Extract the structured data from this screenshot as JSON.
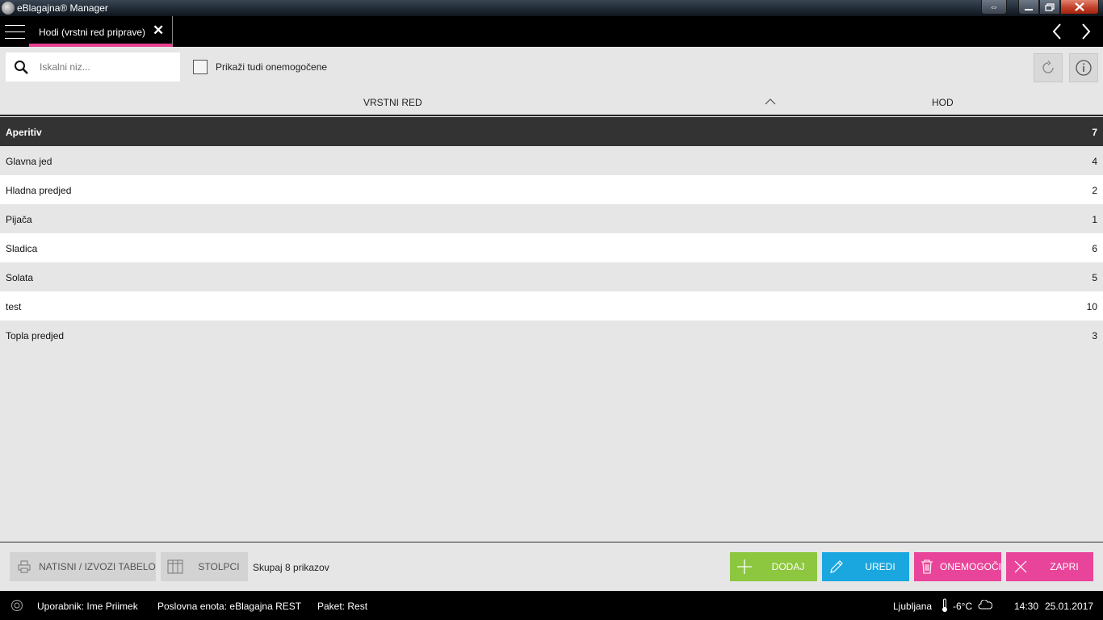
{
  "window": {
    "title": "eBlagajna® Manager"
  },
  "tab": {
    "label": "Hodi (vrstni red priprave)"
  },
  "toolbar": {
    "search_placeholder": "Iskalni niz...",
    "search_value": "",
    "show_disabled_label": "Prikaži tudi onemogočene",
    "show_disabled_checked": false
  },
  "table": {
    "columns": [
      "VRSTNI RED",
      "HOD"
    ],
    "sort_column": "VRSTNI RED",
    "sort_direction": "ascending",
    "rows": [
      {
        "name": "Aperitiv",
        "value": "7"
      },
      {
        "name": "Glavna jed",
        "value": "4"
      },
      {
        "name": "Hladna predjed",
        "value": "2"
      },
      {
        "name": "Pijača",
        "value": "1"
      },
      {
        "name": "Sladica",
        "value": "6"
      },
      {
        "name": "Solata",
        "value": "5"
      },
      {
        "name": "test",
        "value": "10"
      },
      {
        "name": "Topla predjed",
        "value": "3"
      }
    ],
    "selected_row": 0
  },
  "footer": {
    "print_label": "NATISNI / IZVOZI TABELO",
    "columns_label": "STOLPCI",
    "total_label": "Skupaj 8 prikazov",
    "add_label": "DODAJ",
    "edit_label": "UREDI",
    "disable_label": "ONEMOGOČI",
    "close_label": "ZAPRI"
  },
  "status": {
    "user": "Uporabnik: Ime Priimek",
    "business_unit": "Poslovna enota: eBlagajna REST",
    "package": "Paket: Rest",
    "city": "Ljubljana",
    "temperature": "-6°C",
    "time": "14:30",
    "date": "25.01.2017"
  },
  "colors": {
    "accent_pink": "#e8459a",
    "add_green": "#8dc63f",
    "edit_blue": "#1aa7e0",
    "selected_row": "#333333"
  },
  "icons": [
    "app-icon",
    "menu-icon",
    "close-icon",
    "chevron-left-icon",
    "chevron-right-icon",
    "search-icon",
    "refresh-icon",
    "info-icon",
    "sort-up-icon",
    "printer-icon",
    "columns-icon",
    "plus-icon",
    "pencil-icon",
    "trash-icon",
    "x-icon",
    "power-icon",
    "thermometer-icon",
    "cloud-icon"
  ]
}
